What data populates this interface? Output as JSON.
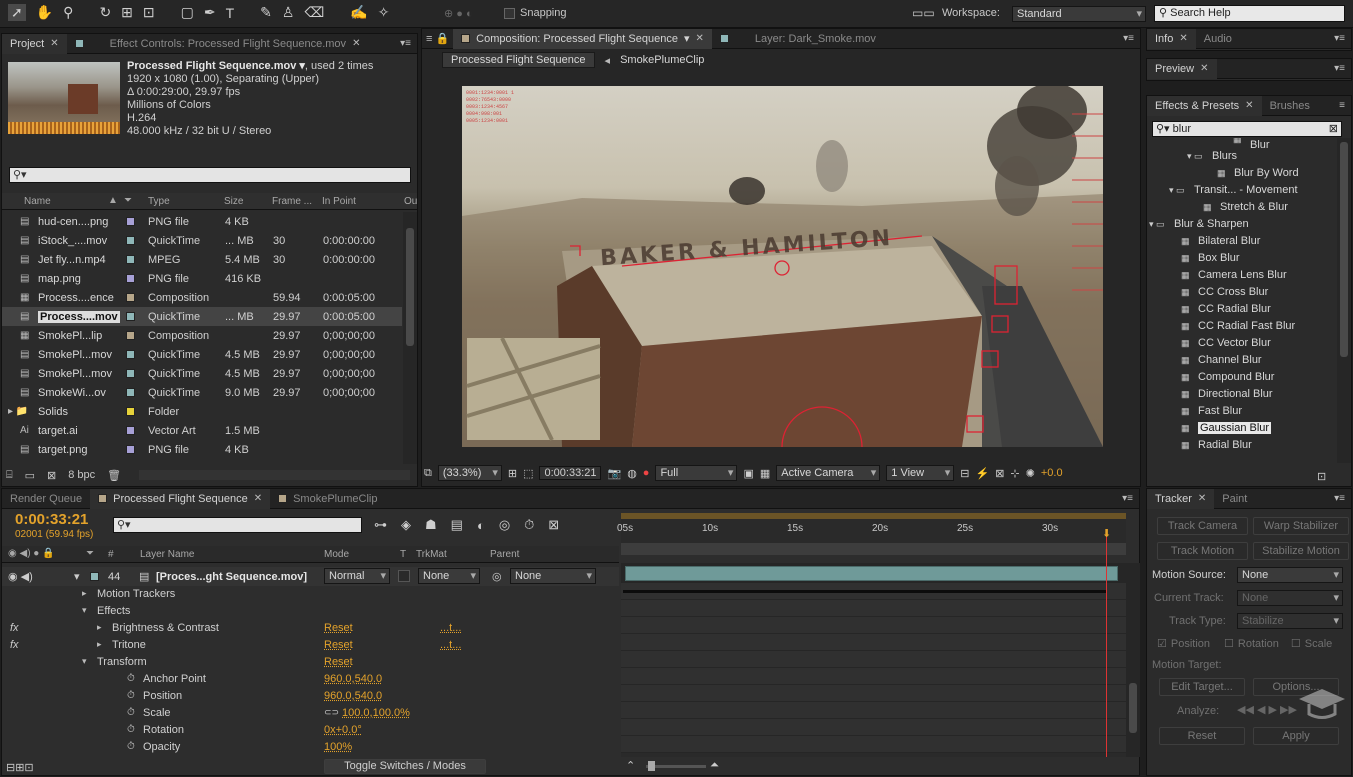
{
  "toolbar": {
    "snapping": "Snapping",
    "workspace_label": "Workspace:",
    "workspace_value": "Standard",
    "search_help": "Search Help"
  },
  "project": {
    "tab": "Project",
    "effect_tab": "Effect Controls: Processed Flight Sequence.mov",
    "item_name": "Processed Flight Sequence.mov ▾",
    "item_used": ", used 2 times",
    "info_lines": [
      "1920 x 1080 (1.00), Separating (Upper)",
      "Δ 0:00:29:00, 29.97 fps",
      "Millions of Colors",
      "H.264",
      "48.000 kHz / 32 bit U / Stereo"
    ],
    "columns": [
      "Name",
      "Type",
      "Size",
      "Frame ...",
      "In Point",
      "Ou"
    ],
    "rows": [
      {
        "name": "hud-cen....png",
        "color": "#a7a0d6",
        "type": "PNG file",
        "size": "4 KB",
        "fps": "",
        "in": ""
      },
      {
        "name": "iStock_....mov",
        "color": "#8fb7b8",
        "type": "QuickTime",
        "size": "... MB",
        "fps": "30",
        "in": "0:00:00:00"
      },
      {
        "name": "Jet fly...n.mp4",
        "color": "#8fb7b8",
        "type": "MPEG",
        "size": "5.4 MB",
        "fps": "30",
        "in": "0:00:00:00"
      },
      {
        "name": "map.png",
        "color": "#a7a0d6",
        "type": "PNG file",
        "size": "416 KB",
        "fps": "",
        "in": ""
      },
      {
        "name": "Process....ence",
        "color": "#b6a68a",
        "type": "Composition",
        "size": "",
        "fps": "59.94",
        "in": "0:00:05:00"
      },
      {
        "name": "Process....mov",
        "color": "#8fb7b8",
        "type": "QuickTime",
        "size": "... MB",
        "fps": "29.97",
        "in": "0:00:05:00"
      },
      {
        "name": "SmokePl...lip",
        "color": "#b6a68a",
        "type": "Composition",
        "size": "",
        "fps": "29.97",
        "in": "0;00;00;00"
      },
      {
        "name": "SmokePl...mov",
        "color": "#8fb7b8",
        "type": "QuickTime",
        "size": "4.5 MB",
        "fps": "29.97",
        "in": "0;00;00;00"
      },
      {
        "name": "SmokePl...mov",
        "color": "#8fb7b8",
        "type": "QuickTime",
        "size": "4.5 MB",
        "fps": "29.97",
        "in": "0;00;00;00"
      },
      {
        "name": "SmokeWi...ov",
        "color": "#8fb7b8",
        "type": "QuickTime",
        "size": "9.0 MB",
        "fps": "29.97",
        "in": "0;00;00;00"
      },
      {
        "name": "Solids",
        "color": "#e6d23a",
        "type": "Folder",
        "size": "",
        "fps": "",
        "in": ""
      },
      {
        "name": "target.ai",
        "color": "#a7a0d6",
        "type": "Vector Art",
        "size": "1.5 MB",
        "fps": "",
        "in": ""
      },
      {
        "name": "target.png",
        "color": "#a7a0d6",
        "type": "PNG file",
        "size": "4 KB",
        "fps": "",
        "in": ""
      }
    ],
    "bpc": "8 bpc"
  },
  "comp": {
    "tab": "Composition: Processed Flight Sequence",
    "layer_tab": "Layer: Dark_Smoke.mov",
    "crumb1": "Processed Flight Sequence",
    "crumb2": "SmokePlumeClip",
    "overlay_title": "BAKER & HAMILTON",
    "zoom": "(33.3%)",
    "timecode": "0:00:33:21",
    "resolution": "Full",
    "camera": "Active Camera",
    "views": "1 View",
    "exposure": "+0.0"
  },
  "info_panel": {
    "tab_info": "Info",
    "tab_audio": "Audio",
    "tab_preview": "Preview",
    "tab_effects": "Effects & Presets",
    "tab_brushes": "Brushes",
    "search": "blur",
    "items": [
      "3D Fall...ble & Blur",
      "Blurs",
      "Blur By Word",
      "Transit... - Movement",
      "Stretch & Blur",
      "Blur & Sharpen",
      "Bilateral Blur",
      "Box Blur",
      "Camera Lens Blur",
      "CC Cross Blur",
      "CC Radial Blur",
      "CC Radial Fast Blur",
      "CC Vector Blur",
      "Channel Blur",
      "Compound Blur",
      "Directional Blur",
      "Fast Blur",
      "Gaussian Blur",
      "Radial Blur"
    ]
  },
  "timeline": {
    "tab_render": "Render Queue",
    "tab_comp": "Processed Flight Sequence",
    "tab_smoke": "SmokePlumeClip",
    "timecode": "0:00:33:21",
    "frames": "02001 (59.94 fps)",
    "cols": {
      "layer_name": "Layer Name",
      "mode": "Mode",
      "t": "T",
      "trkmat": "TrkMat",
      "parent": "Parent",
      "num": "#"
    },
    "layer": {
      "num": "44",
      "name": "[Proces...ght Sequence.mov]",
      "mode": "Normal",
      "trkmat": "None",
      "parent": "None"
    },
    "props": {
      "motion_trackers": "Motion Trackers",
      "effects": "Effects",
      "bc": "Brightness & Contrast",
      "tritone": "Tritone",
      "reset": "Reset",
      "dots": "...t...",
      "transform": "Transform",
      "anchor": "Anchor Point",
      "anchor_v": "960.0,540.0",
      "position": "Position",
      "position_v": "960.0,540.0",
      "scale": "Scale",
      "scale_v": "100.0,100.0%",
      "rotation": "Rotation",
      "rotation_v": "0x+0.0°",
      "opacity": "Opacity",
      "opacity_v": "100%"
    },
    "ruler": [
      "05s",
      "10s",
      "15s",
      "20s",
      "25s",
      "30s"
    ],
    "toggle": "Toggle Switches / Modes"
  },
  "tracker": {
    "tab": "Tracker",
    "tab_paint": "Paint",
    "track_camera": "Track Camera",
    "warp": "Warp Stabilizer",
    "track_motion": "Track Motion",
    "stabilize": "Stabilize Motion",
    "motion_source": "Motion Source:",
    "motion_source_v": "None",
    "current_track": "Current Track:",
    "current_track_v": "None",
    "track_type": "Track Type:",
    "track_type_v": "Stabilize",
    "position": "Position",
    "rotation": "Rotation",
    "scale": "Scale",
    "motion_target": "Motion Target:",
    "edit_target": "Edit Target...",
    "options": "Options...",
    "analyze": "Analyze:",
    "reset": "Reset",
    "apply": "Apply"
  }
}
